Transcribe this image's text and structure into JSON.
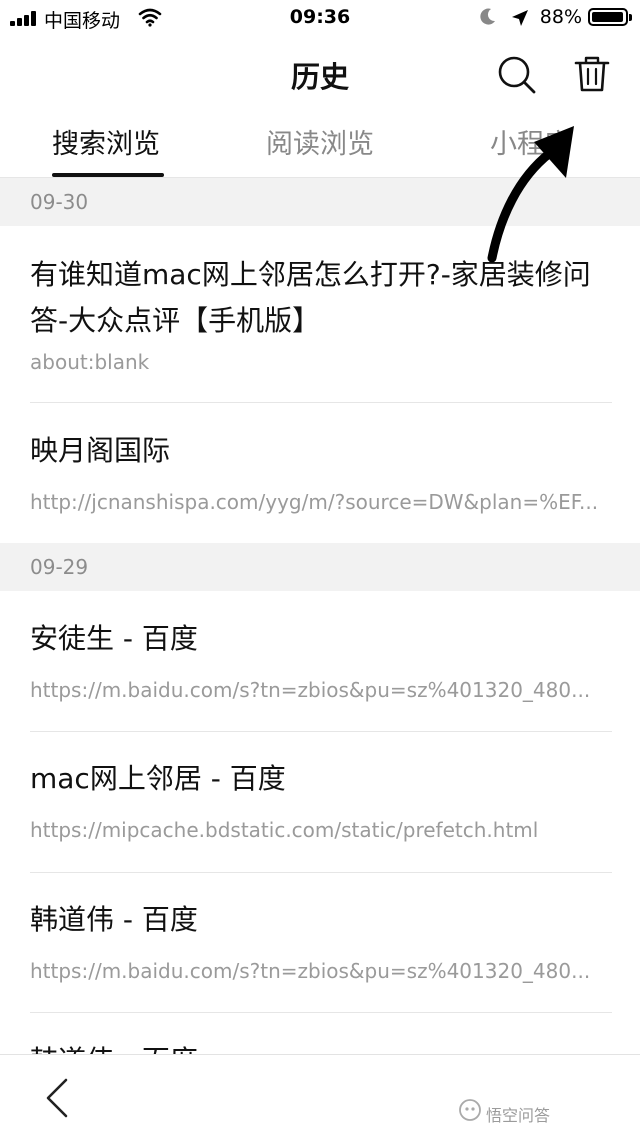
{
  "status_bar": {
    "carrier": "中国移动",
    "time": "09:36",
    "battery": "88%",
    "battery_level": 0.88
  },
  "nav": {
    "title": "历史"
  },
  "tabs": [
    {
      "label": "搜索浏览",
      "active": true
    },
    {
      "label": "阅读浏览",
      "active": false
    },
    {
      "label": "小程序",
      "active": false
    }
  ],
  "groups": [
    {
      "date": "09-30",
      "items": [
        {
          "title": "有谁知道mac网上邻居怎么打开?-家居装修问答-大众点评【手机版】",
          "url": "about:blank"
        },
        {
          "title": "映月阁国际",
          "url": "http://jcnanshispa.com/yyg/m/?source=DW&plan=%EF..."
        }
      ]
    },
    {
      "date": "09-29",
      "items": [
        {
          "title": "安徒生 - 百度",
          "url": "https://m.baidu.com/s?tn=zbios&pu=sz%401320_480..."
        },
        {
          "title": "mac网上邻居 - 百度",
          "url": "https://mipcache.bdstatic.com/static/prefetch.html"
        },
        {
          "title": "韩道伟 - 百度",
          "url": "https://m.baidu.com/s?tn=zbios&pu=sz%401320_480..."
        },
        {
          "title": "韩道伟 - 百度",
          "url": ""
        }
      ]
    }
  ],
  "watermark": "悟空问答",
  "icons": {
    "search": "search-icon",
    "trash": "trash-icon",
    "back": "chevron-left-icon"
  }
}
